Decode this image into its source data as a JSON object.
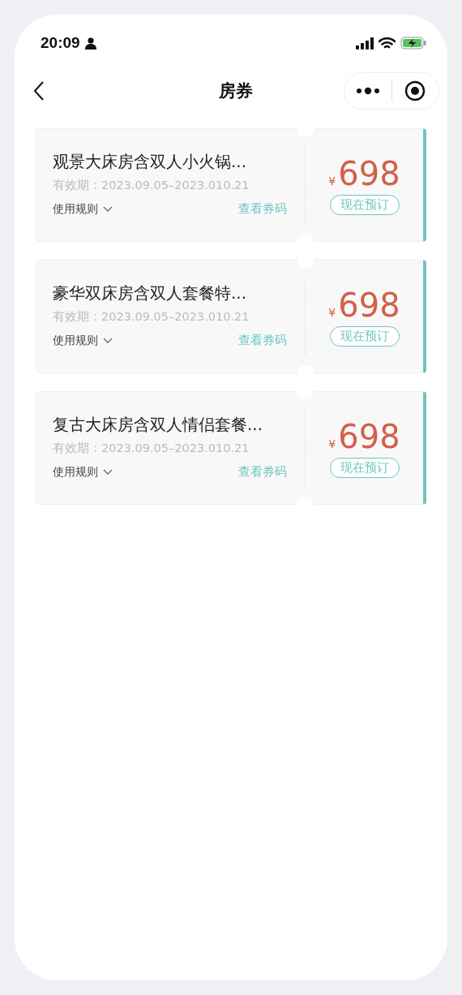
{
  "status_bar": {
    "time": "20:09"
  },
  "nav": {
    "title": "房券"
  },
  "coupons": [
    {
      "title": "观景大床房含双人小火锅...",
      "validity": "有效期：2023.09.05–2023.010.21",
      "rules": "使用规则",
      "view_code": "查看券码",
      "currency": "¥",
      "price": "698",
      "book": "现在预订"
    },
    {
      "title": "豪华双床房含双人套餐特...",
      "validity": "有效期：2023.09.05–2023.010.21",
      "rules": "使用规则",
      "view_code": "查看券码",
      "currency": "¥",
      "price": "698",
      "book": "现在预订"
    },
    {
      "title": "复古大床房含双人情侣套餐...",
      "validity": "有效期：2023.09.05–2023.010.21",
      "rules": "使用规则",
      "view_code": "查看券码",
      "currency": "¥",
      "price": "698",
      "book": "现在预订"
    }
  ]
}
